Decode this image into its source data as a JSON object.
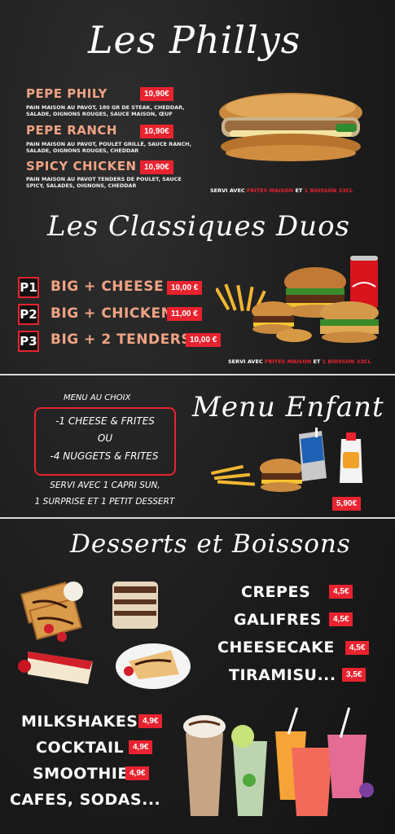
{
  "phillys": {
    "title": "Les Phillys",
    "items": [
      {
        "name": "PEPE PHILY",
        "price": "10,90€",
        "desc": "PAIN MAISON AU PAVOT, 180 GR DE STEAK, CHEDDAR, SALADE, OIGNONS ROUGES, SAUCE MAISON, ŒUF"
      },
      {
        "name": "PEPE RANCH",
        "price": "10,90€",
        "desc": "PAIN MAISON AU PAVOT, POULET GRILLÉ, SAUCE RANCH, SALADE, OIGNONS ROUGES, CHEDDAR"
      },
      {
        "name": "SPICY CHICKEN",
        "price": "10,90€",
        "desc": "PAIN MAISON AU PAVOT TENDERS DE POULET, SAUCE SPICY, SALADES, OIGNONS, CHEDDAR"
      }
    ],
    "served_prefix": "SERVI AVEC",
    "served_fries": "FRITES MAISON",
    "served_mid": "ET",
    "served_drink": "1 BOISSON 33CL"
  },
  "duos": {
    "title": "Les Classiques Duos",
    "items": [
      {
        "code": "P1",
        "name": "BIG + CHEESE",
        "price": "10,00 €"
      },
      {
        "code": "P2",
        "name": "BIG + CHICKEN",
        "price": "11,00 €"
      },
      {
        "code": "P3",
        "name": "BIG + 2 TENDERS",
        "price": "10,00 €"
      }
    ],
    "served_prefix": "SERVI AVEC",
    "served_fries": "FRITES MAISON",
    "served_mid": "ET",
    "served_drink": "1 BOISSON 33CL"
  },
  "kids": {
    "title": "Menu Enfant",
    "choice_label": "MENU AU CHOIX",
    "option1": "-1 CHEESE & FRITES",
    "or": "OU",
    "option2": "-4 NUGGETS & FRITES",
    "served_line1": "SERVI AVEC 1 CAPRI SUN,",
    "served_line2": "1 SURPRISE ET 1 PETIT DESSERT",
    "price": "5,90€"
  },
  "desserts": {
    "title": "Desserts et Boissons",
    "items": [
      {
        "name": "CREPES",
        "price": "4,5€"
      },
      {
        "name": "GALIFRES",
        "price": "4,5€"
      },
      {
        "name": "CHEESECAKE",
        "price": "4,5€"
      },
      {
        "name": "TIRAMISU...",
        "price": "3,5€"
      }
    ],
    "drinks": [
      {
        "name": "MILKSHAKES",
        "price": "4,9€"
      },
      {
        "name": "COCKTAIL",
        "price": "4,9€"
      },
      {
        "name": "SMOOTHIE",
        "price": "4,9€"
      },
      {
        "name": "CAFES, SODAS...",
        "price": ""
      }
    ]
  },
  "colors": {
    "accent_red": "#e8232f",
    "salmon": "#f0a383",
    "background": "#1f1f1f"
  }
}
